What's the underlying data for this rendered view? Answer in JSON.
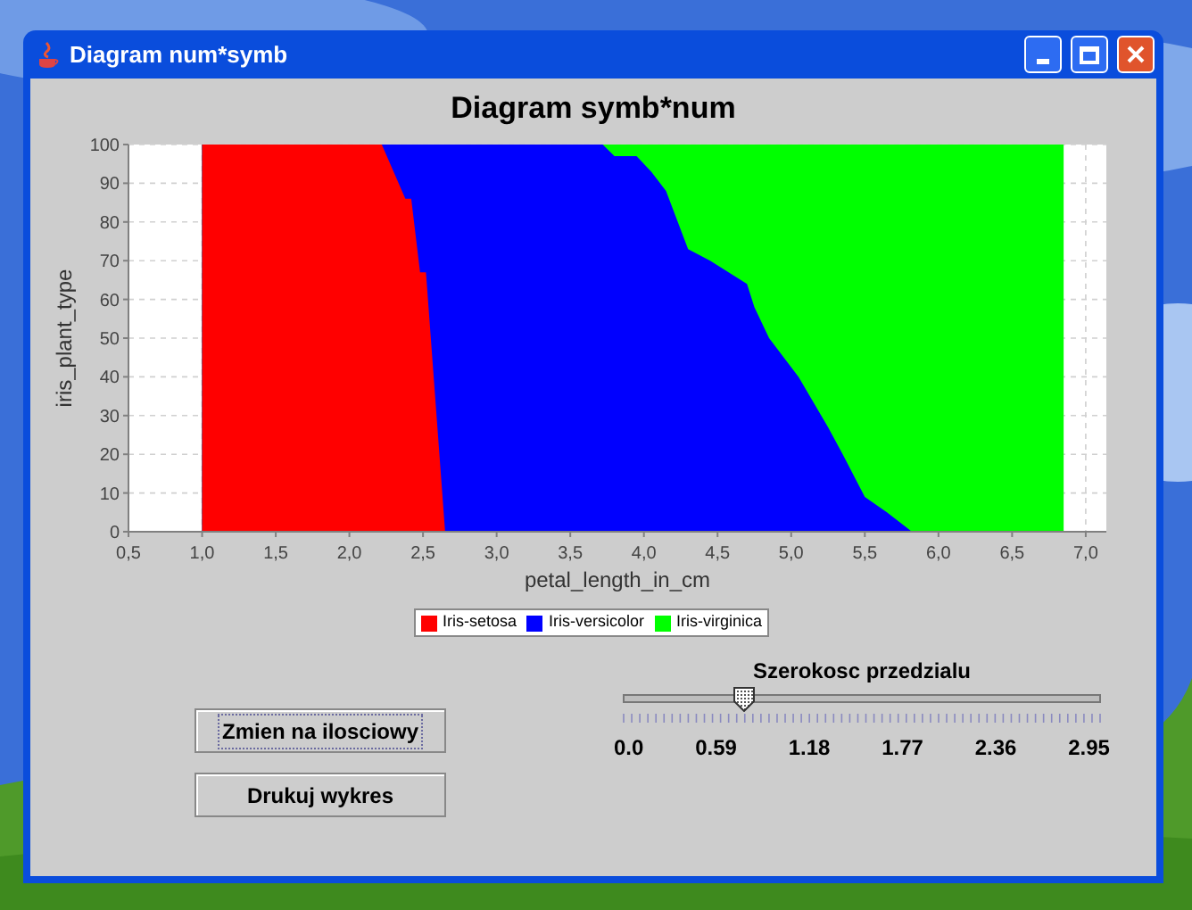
{
  "window": {
    "title": "Diagram num*symb"
  },
  "chart": {
    "chart_data": {
      "type": "area",
      "stacked": false,
      "grid": true,
      "title": "Diagram symb*num",
      "xlabel": "petal_length_in_cm",
      "ylabel": "iris_plant_type",
      "x": [
        1.0,
        2.22,
        2.38,
        2.42,
        2.48,
        2.52,
        2.65,
        3.72,
        3.8,
        3.95,
        4.05,
        4.15,
        4.3,
        4.45,
        4.7,
        4.75,
        4.85,
        5.05,
        5.25,
        5.35,
        5.5,
        5.65,
        5.82,
        6.85
      ],
      "series": [
        {
          "name": "Iris-setosa",
          "color": "#ff0000",
          "values": [
            100,
            100,
            86,
            86,
            67,
            67,
            0,
            null,
            null,
            null,
            null,
            null,
            null,
            null,
            null,
            null,
            null,
            null,
            null,
            null,
            null,
            null,
            null,
            null
          ]
        },
        {
          "name": "Iris-versicolor",
          "color": "#0000ff",
          "values": [
            100,
            100,
            100,
            100,
            100,
            100,
            100,
            100,
            97,
            97,
            93,
            88,
            73,
            70,
            64,
            58,
            50,
            40,
            27,
            20,
            9,
            5,
            0,
            null
          ]
        },
        {
          "name": "Iris-virginica",
          "color": "#00ff00",
          "values": [
            100,
            100,
            100,
            100,
            100,
            100,
            100,
            100,
            100,
            100,
            100,
            100,
            100,
            100,
            100,
            100,
            100,
            100,
            100,
            100,
            100,
            100,
            100,
            100
          ]
        }
      ],
      "xlim": [
        0.5,
        7.14
      ],
      "ylim": [
        0,
        100
      ],
      "xticks": [
        {
          "value": 0.5,
          "label": "0,5"
        },
        {
          "value": 1.0,
          "label": "1,0"
        },
        {
          "value": 1.5,
          "label": "1,5"
        },
        {
          "value": 2.0,
          "label": "2,0"
        },
        {
          "value": 2.5,
          "label": "2,5"
        },
        {
          "value": 3.0,
          "label": "3,0"
        },
        {
          "value": 3.5,
          "label": "3,5"
        },
        {
          "value": 4.0,
          "label": "4,0"
        },
        {
          "value": 4.5,
          "label": "4,5"
        },
        {
          "value": 5.0,
          "label": "5,0"
        },
        {
          "value": 5.5,
          "label": "5,5"
        },
        {
          "value": 6.0,
          "label": "6,0"
        },
        {
          "value": 6.5,
          "label": "6,5"
        },
        {
          "value": 7.0,
          "label": "7,0"
        }
      ],
      "yticks": [
        0,
        10,
        20,
        30,
        40,
        50,
        60,
        70,
        80,
        90,
        100
      ]
    }
  },
  "slider": {
    "title": "Szerokosc przedzialu",
    "level": 0.25,
    "labels": [
      "0.0",
      "0.59",
      "1.18",
      "1.77",
      "2.36",
      "2.95"
    ]
  },
  "buttons": [
    {
      "label": "Zmien na ilosciowy",
      "focused": true
    },
    {
      "label": "Drukuj wykres",
      "focused": false
    }
  ]
}
